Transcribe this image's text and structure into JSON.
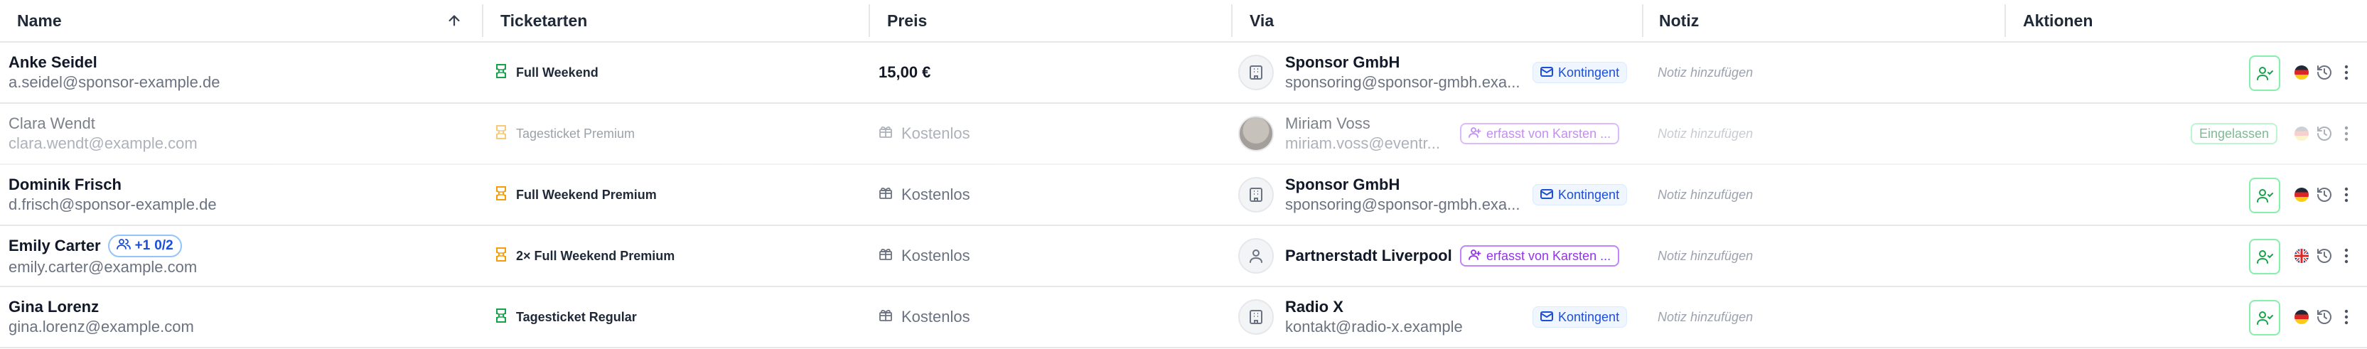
{
  "columns": {
    "name": "Name",
    "tickets": "Ticketarten",
    "price": "Preis",
    "via": "Via",
    "note": "Notiz",
    "actions": "Aktionen"
  },
  "rows": [
    {
      "name": "Anke Seidel",
      "email": "a.seidel@sponsor-example.de",
      "ticket": "Full Weekend",
      "ticket_icon_color": "#16a34a",
      "price": "15,00 €",
      "via_name": "Sponsor GmbH",
      "via_email": "sponsoring@sponsor-gmbh.exa...",
      "via_badge": "Kontingent",
      "note_placeholder": "Notiz hinzufügen"
    },
    {
      "name": "Clara Wendt",
      "email": "clara.wendt@example.com",
      "ticket": "Tagesticket Premium",
      "ticket_icon_color": "#f59e0b",
      "price": "Kostenlos",
      "via_name": "Miriam Voss",
      "via_email": "miriam.voss@eventr...",
      "via_badge": "erfasst von Karsten ...",
      "note_placeholder": "Notiz hinzufügen",
      "status": "Eingelassen"
    },
    {
      "name": "Dominik Frisch",
      "email": "d.frisch@sponsor-example.de",
      "ticket": "Full Weekend Premium",
      "ticket_icon_color": "#f59e0b",
      "price": "Kostenlos",
      "via_name": "Sponsor GmbH",
      "via_email": "sponsoring@sponsor-gmbh.exa...",
      "via_badge": "Kontingent",
      "note_placeholder": "Notiz hinzufügen"
    },
    {
      "name": "Emily Carter",
      "email": "emily.carter@example.com",
      "group_plus": "+1",
      "group_count": "0/2",
      "ticket": "2× Full Weekend Premium",
      "ticket_icon_color": "#f59e0b",
      "price": "Kostenlos",
      "via_name": "Partnerstadt Liverpool",
      "via_badge": "erfasst von Karsten ...",
      "note_placeholder": "Notiz hinzufügen"
    },
    {
      "name": "Gina Lorenz",
      "email": "gina.lorenz@example.com",
      "ticket": "Tagesticket Regular",
      "ticket_icon_color": "#16a34a",
      "price": "Kostenlos",
      "via_name": "Radio X",
      "via_email": "kontakt@radio-x.example",
      "via_badge": "Kontingent",
      "note_placeholder": "Notiz hinzufügen"
    }
  ],
  "icons": {
    "sort": "arrow-up-icon",
    "ticket": "ticket-icon",
    "gift": "gift-icon",
    "building": "building-icon",
    "user": "user-icon",
    "mail": "mail-icon",
    "user_plus": "user-plus-icon",
    "flag_de": "flag-de-icon",
    "flag_gb": "flag-gb-icon",
    "history": "history-icon",
    "more": "more-vertical-icon"
  },
  "colors": {
    "kontingent_bg": "#eff6ff",
    "kontingent_text": "#1d4ed8",
    "erfasst_text": "#9333ea",
    "eingelassen_text": "#15803d",
    "checkin_border": "#86efac"
  }
}
